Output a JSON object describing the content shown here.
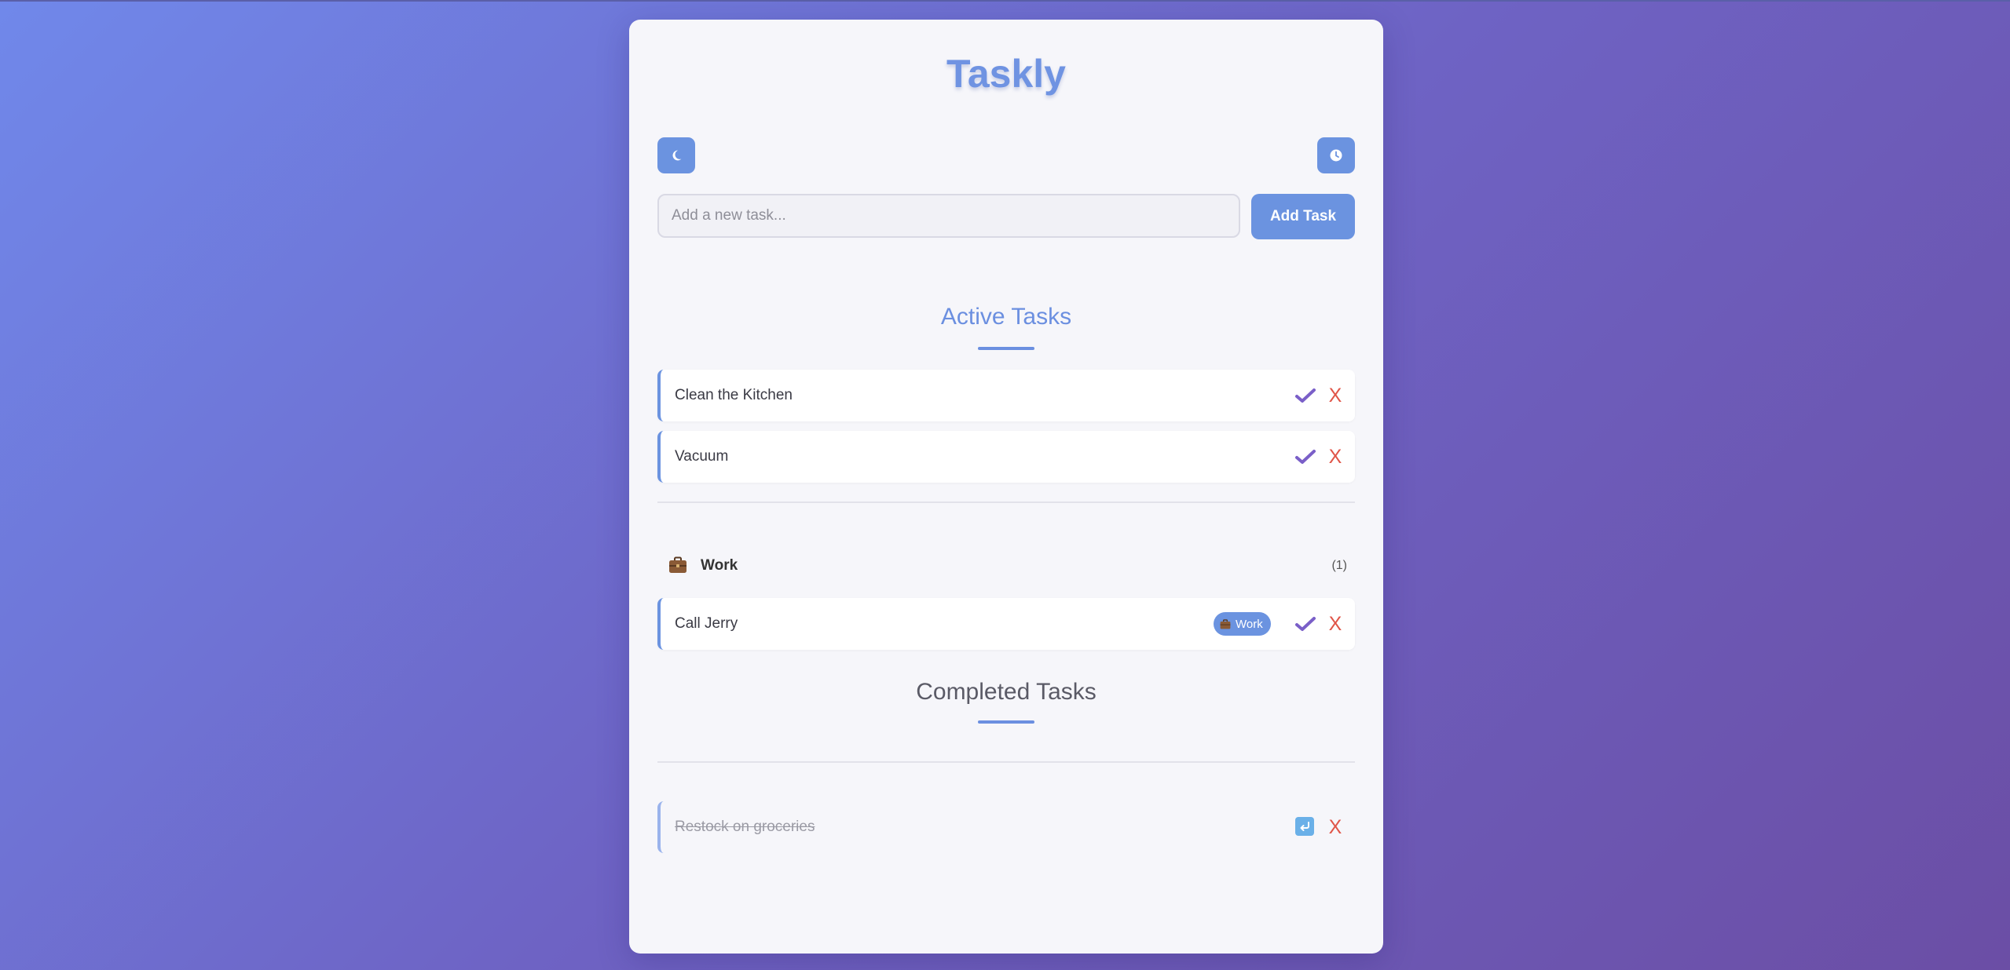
{
  "app": {
    "title": "Taskly"
  },
  "toolbar": {
    "theme_icon": "moon-icon",
    "history_icon": "clock-icon"
  },
  "input": {
    "value": "",
    "placeholder": "Add a new task..."
  },
  "add_button": {
    "label": "Add Task"
  },
  "active": {
    "title": "Active Tasks",
    "tasks": [
      {
        "text": "Clean the Kitchen"
      },
      {
        "text": "Vacuum"
      }
    ],
    "categories": [
      {
        "name": "Work",
        "count": "(1)",
        "icon": "briefcase-icon",
        "tasks": [
          {
            "text": "Call Jerry",
            "tag": "Work"
          }
        ]
      }
    ]
  },
  "completed": {
    "title": "Completed Tasks",
    "tasks": [
      {
        "text": "Restock on groceries"
      }
    ]
  },
  "actions": {
    "delete_label": "X"
  },
  "colors": {
    "accent": "#6b93e0",
    "check": "#7a5fc8",
    "delete": "#e05548",
    "undo": "#6ab0e8",
    "background_start": "#7088ea",
    "background_end": "#6b4ea5"
  }
}
